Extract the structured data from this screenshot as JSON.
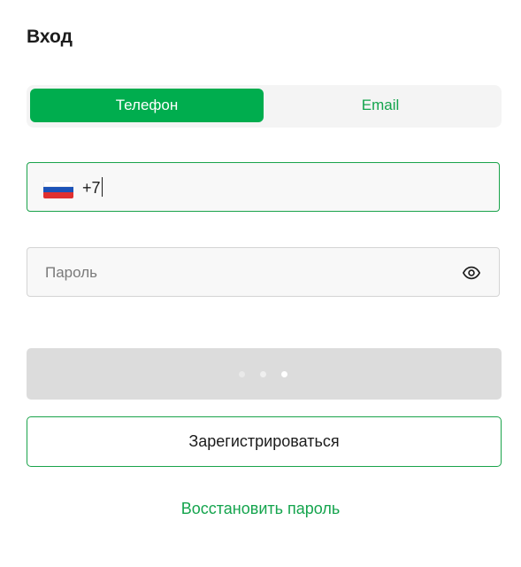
{
  "page": {
    "title": "Вход"
  },
  "auth_tabs": {
    "items": [
      {
        "label": "Телефон",
        "active": true
      },
      {
        "label": "Email",
        "active": false
      }
    ]
  },
  "phone_field": {
    "country_flag": "russia-flag-icon",
    "value": "+7"
  },
  "password_field": {
    "placeholder": "Пароль",
    "toggle_icon": "eye-icon"
  },
  "login_button": {
    "state": "loading",
    "icon": "loading-dots-icon"
  },
  "register_button": {
    "label": "Зарегистрироваться"
  },
  "restore_link": {
    "label": "Восстановить пароль"
  },
  "colors": {
    "accent": "#00ad4e",
    "accent_text": "#14a44d",
    "border_focus": "#1aa34a",
    "disabled_bg": "#dcdcdc"
  }
}
